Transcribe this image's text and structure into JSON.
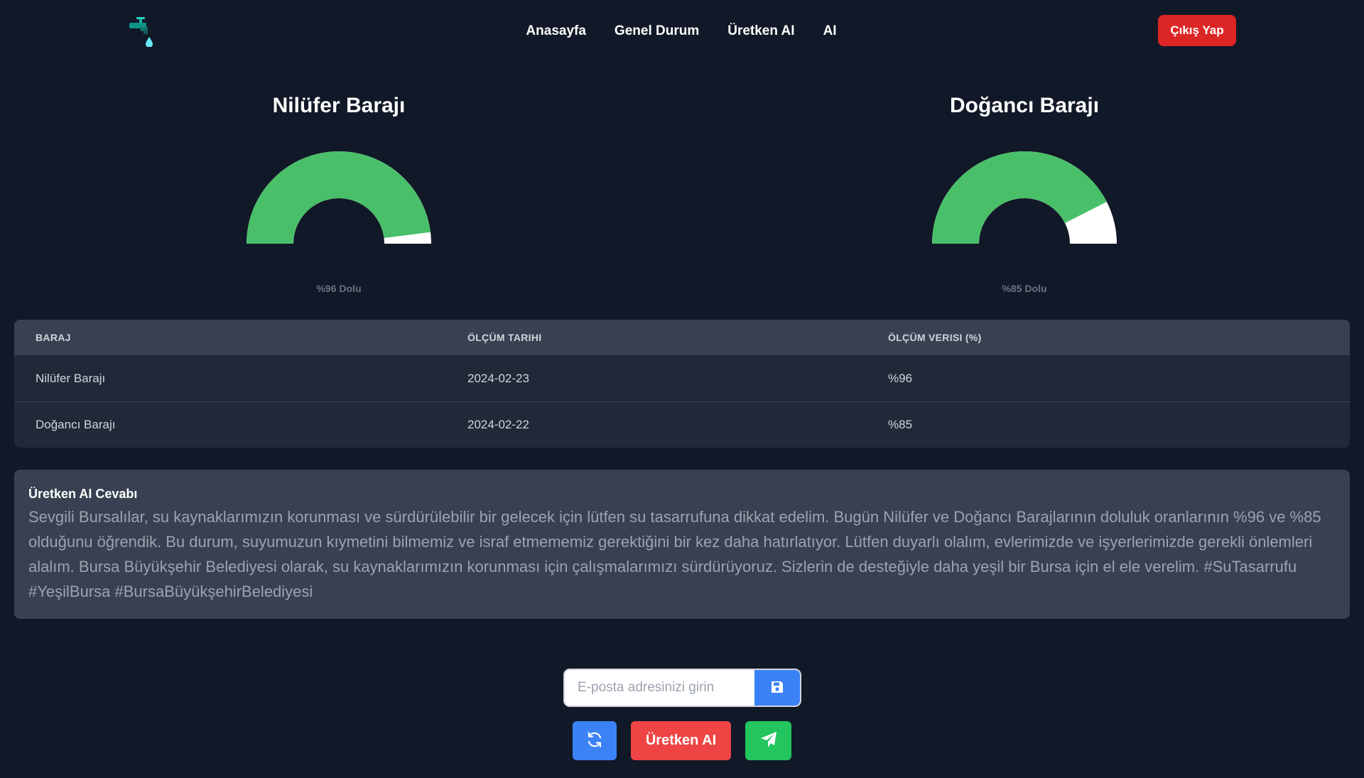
{
  "nav": {
    "links": [
      "Anasayfa",
      "Genel Durum",
      "Üretken AI",
      "AI"
    ],
    "logout_label": "Çıkış Yap",
    "logo_icon": "water-faucet-icon"
  },
  "gauges": [
    {
      "title": "Nilüfer Barajı",
      "percent": 96,
      "label": "%96 Dolu"
    },
    {
      "title": "Doğancı Barajı",
      "percent": 85,
      "label": "%85 Dolu"
    }
  ],
  "table": {
    "headers": [
      "BARAJ",
      "ÖLÇÜM TARIHI",
      "ÖLÇÜM VERISI (%)"
    ],
    "rows": [
      [
        "Nilüfer Barajı",
        "2024-02-23",
        "%96"
      ],
      [
        "Doğancı Barajı",
        "2024-02-22",
        "%85"
      ]
    ]
  },
  "ai_response": {
    "title": "Üretken AI Cevabı",
    "text": "Sevgili Bursalılar, su kaynaklarımızın korunması ve sürdürülebilir bir gelecek için lütfen su tasarrufuna dikkat edelim. Bugün Nilüfer ve Doğancı Barajlarının doluluk oranlarının %96 ve %85 olduğunu öğrendik. Bu durum, suyumuzun kıymetini bilmemiz ve israf etmememiz gerektiğini bir kez daha hatırlatıyor. Lütfen duyarlı olalım, evlerimizde ve işyerlerimizde gerekli önlemleri alalım. Bursa Büyükşehir Belediyesi olarak, su kaynaklarımızın korunması için çalışmalarımızı sürdürüyoruz. Sizlerin de desteğiyle daha yeşil bir Bursa için el ele verelim. #SuTasarrufu #YeşilBursa #BursaBüyükşehirBelediyesi"
  },
  "email": {
    "placeholder": "E-posta adresinizi girin",
    "value": "",
    "save_icon": "floppy-disk-icon"
  },
  "actions": {
    "refresh_icon": "refresh-icon",
    "ai_label": "Üretken AI",
    "send_icon": "paper-plane-icon"
  },
  "colors": {
    "background": "#111827",
    "gauge_fill": "#4abf6a",
    "gauge_empty": "#ffffff",
    "logout": "#dc2626",
    "primary": "#3b82f6",
    "danger": "#ef4444",
    "success": "#22c55e"
  }
}
